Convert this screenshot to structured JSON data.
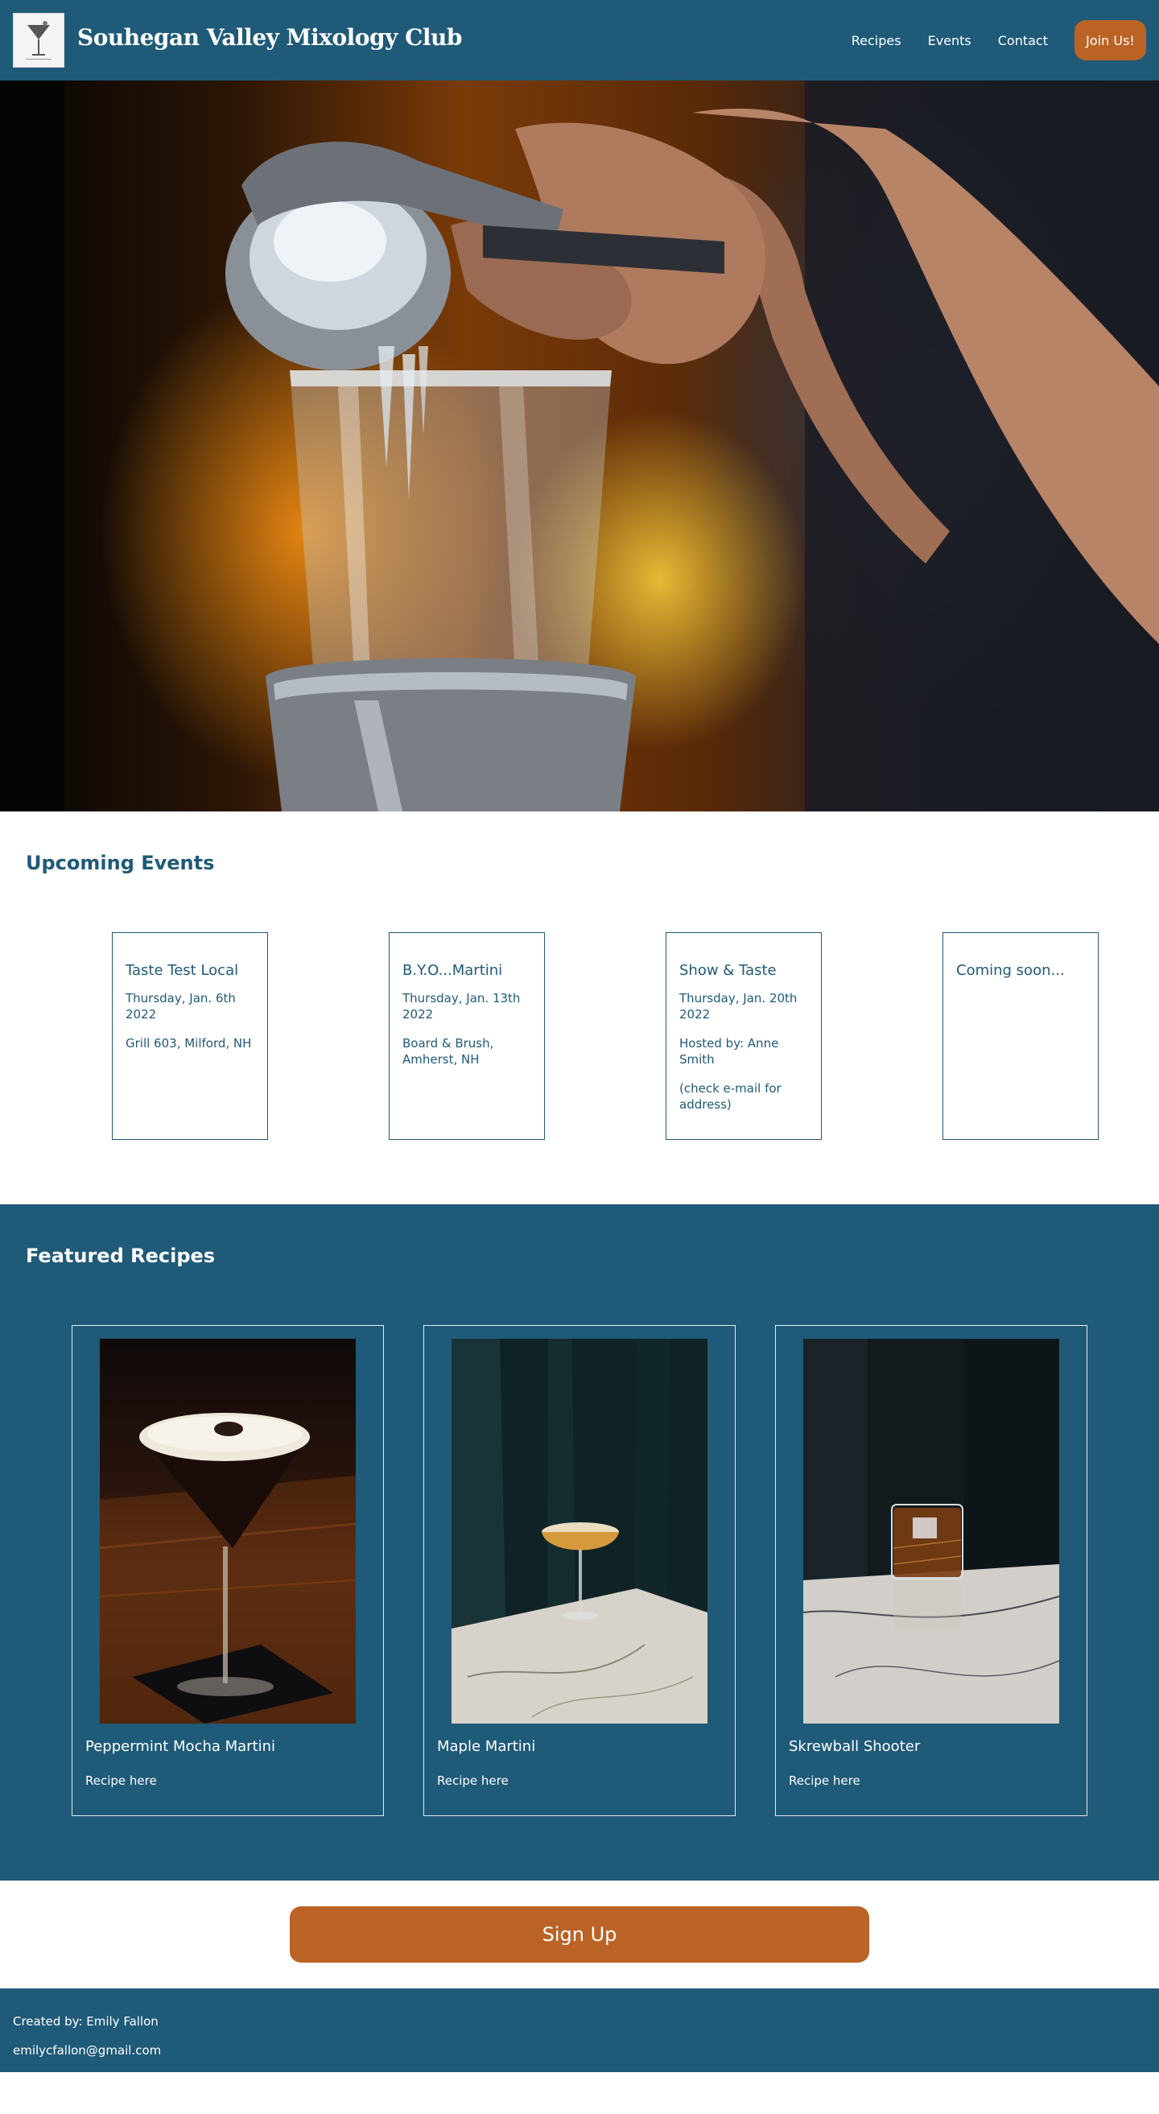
{
  "header": {
    "logo_icon": "martini-glass-icon",
    "title": "Souhegan Valley Mixology Club",
    "nav": [
      {
        "label": "Recipes"
      },
      {
        "label": "Events"
      },
      {
        "label": "Contact"
      }
    ],
    "join_label": "Join Us!"
  },
  "hero": {
    "image": "bartender-squeezing-citrus-into-mixing-glass"
  },
  "events": {
    "title": "Upcoming Events",
    "cards": [
      {
        "name": "Taste Test Local",
        "date": "Thursday, Jan. 6th 2022",
        "location": "Grill 603, Milford, NH",
        "note": ""
      },
      {
        "name": "B.Y.O...Martini",
        "date": "Thursday, Jan. 13th 2022",
        "location": "Board & Brush, Amherst, NH",
        "note": ""
      },
      {
        "name": "Show & Taste",
        "date": "Thursday, Jan. 20th 2022",
        "location": "Hosted by: Anne Smith",
        "note": "(check e-mail for address)"
      },
      {
        "name": "Coming soon...",
        "date": "",
        "location": "",
        "note": ""
      }
    ]
  },
  "recipes": {
    "title": "Featured Recipes",
    "cards": [
      {
        "name": "Peppermint Mocha Martini",
        "link": "Recipe here",
        "image": "espresso-martini-photo"
      },
      {
        "name": "Maple Martini",
        "link": "Recipe here",
        "image": "coupe-cocktail-on-marble-photo"
      },
      {
        "name": "Skrewball Shooter",
        "link": "Recipe here",
        "image": "rocks-glass-on-marble-photo"
      }
    ]
  },
  "signup": {
    "label": "Sign Up"
  },
  "footer": {
    "created_by": "Created by: Emily Fallon",
    "email": "emilycfallon@gmail.com"
  },
  "colors": {
    "primary": "#1f5a78",
    "accent": "#bb6325",
    "background": "#ffffff"
  }
}
